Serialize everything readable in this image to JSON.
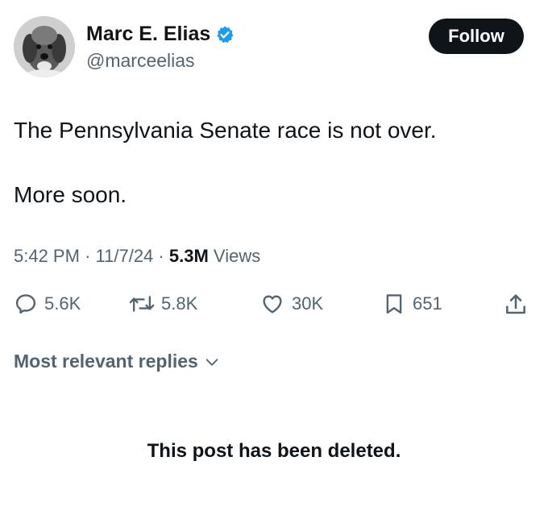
{
  "author": {
    "display_name": "Marc E. Elias",
    "handle": "@marceelias",
    "verified": true,
    "verified_color": "#1d9bf0",
    "avatar_icon": "dog-photo-avatar"
  },
  "follow_button": {
    "label": "Follow"
  },
  "tweet": {
    "lines": [
      "The Pennsylvania Senate race is not over.",
      "More soon."
    ],
    "time": "5:42 PM",
    "date": "11/7/24",
    "separator": "·",
    "views_count": "5.3M",
    "views_label": "Views"
  },
  "actions": {
    "replies": {
      "icon": "reply-icon",
      "count": "5.6K"
    },
    "reposts": {
      "icon": "repost-icon",
      "count": "5.8K"
    },
    "likes": {
      "icon": "heart-icon",
      "count": "30K"
    },
    "bookmarks": {
      "icon": "bookmark-icon",
      "count": "651"
    },
    "share": {
      "icon": "share-icon"
    }
  },
  "replies_sort": {
    "label": "Most relevant replies"
  },
  "notice": {
    "text": "This post has been deleted."
  },
  "colors": {
    "text_primary": "#0f1419",
    "text_secondary": "#536471",
    "button_bg": "#0f1419",
    "button_text": "#ffffff"
  }
}
